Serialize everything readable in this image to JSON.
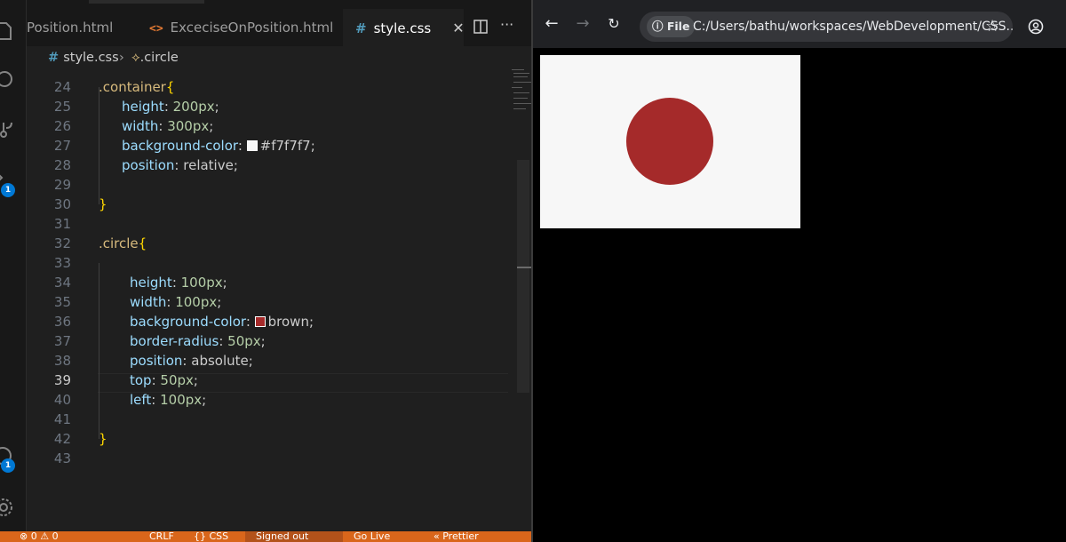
{
  "editor": {
    "tabs": [
      {
        "label": "Position.html",
        "type": "html"
      },
      {
        "label": "ExceciseOnPosition.html",
        "type": "html"
      },
      {
        "label": "style.css",
        "type": "css",
        "active": true
      }
    ],
    "breadcrumb": {
      "file": "style.css",
      "symbol": ".circle"
    },
    "lines": [
      {
        "n": "24",
        "code": [
          {
            "t": ".container",
            "c": "sel"
          },
          {
            "t": "{",
            "c": "brace"
          }
        ]
      },
      {
        "n": "25",
        "code": [
          {
            "t": "height",
            "c": "prop"
          },
          {
            "t": ": ",
            "c": "plain"
          },
          {
            "t": "200px",
            "c": "num"
          },
          {
            "t": ";",
            "c": "plain"
          }
        ]
      },
      {
        "n": "26",
        "code": [
          {
            "t": "width",
            "c": "prop"
          },
          {
            "t": ": ",
            "c": "plain"
          },
          {
            "t": "300px",
            "c": "num"
          },
          {
            "t": ";",
            "c": "plain"
          }
        ]
      },
      {
        "n": "27",
        "code": [
          {
            "t": "background-color",
            "c": "prop"
          },
          {
            "t": ": ",
            "c": "plain"
          },
          {
            "swatch": "#f7f7f7"
          },
          {
            "t": "#f7f7f7",
            "c": "plain"
          },
          {
            "t": ";",
            "c": "plain"
          }
        ]
      },
      {
        "n": "28",
        "code": [
          {
            "t": "position",
            "c": "prop"
          },
          {
            "t": ": ",
            "c": "plain"
          },
          {
            "t": "relative",
            "c": "plain"
          },
          {
            "t": ";",
            "c": "plain"
          }
        ]
      },
      {
        "n": "29",
        "code": []
      },
      {
        "n": "30",
        "code": [
          {
            "t": "}",
            "c": "brace"
          }
        ]
      },
      {
        "n": "31",
        "code": []
      },
      {
        "n": "32",
        "code": [
          {
            "t": ".circle",
            "c": "sel"
          },
          {
            "t": "{",
            "c": "brace"
          }
        ]
      },
      {
        "n": "33",
        "code": []
      },
      {
        "n": "34",
        "code": [
          {
            "t": "height",
            "c": "prop"
          },
          {
            "t": ": ",
            "c": "plain"
          },
          {
            "t": "100px",
            "c": "num"
          },
          {
            "t": ";",
            "c": "plain"
          }
        ]
      },
      {
        "n": "35",
        "code": [
          {
            "t": "width",
            "c": "prop"
          },
          {
            "t": ": ",
            "c": "plain"
          },
          {
            "t": "100px",
            "c": "num"
          },
          {
            "t": ";",
            "c": "plain"
          }
        ]
      },
      {
        "n": "36",
        "code": [
          {
            "t": "background-color",
            "c": "prop"
          },
          {
            "t": ": ",
            "c": "plain"
          },
          {
            "swatch": "#a52a2a"
          },
          {
            "t": "brown",
            "c": "plain"
          },
          {
            "t": ";",
            "c": "plain"
          }
        ]
      },
      {
        "n": "37",
        "code": [
          {
            "t": "border-radius",
            "c": "prop"
          },
          {
            "t": ": ",
            "c": "plain"
          },
          {
            "t": "50px",
            "c": "num"
          },
          {
            "t": ";",
            "c": "plain"
          }
        ]
      },
      {
        "n": "38",
        "code": [
          {
            "t": "position",
            "c": "prop"
          },
          {
            "t": ": ",
            "c": "plain"
          },
          {
            "t": "absolute",
            "c": "plain"
          },
          {
            "t": ";",
            "c": "plain"
          }
        ]
      },
      {
        "n": "39",
        "current": true,
        "code": [
          {
            "t": "top",
            "c": "prop"
          },
          {
            "t": ": ",
            "c": "plain"
          },
          {
            "t": "50px",
            "c": "num"
          },
          {
            "t": ";",
            "c": "plain"
          }
        ]
      },
      {
        "n": "40",
        "code": [
          {
            "t": "left",
            "c": "prop"
          },
          {
            "t": ": ",
            "c": "plain"
          },
          {
            "t": "100px",
            "c": "num"
          },
          {
            "t": ";",
            "c": "plain"
          }
        ]
      },
      {
        "n": "41",
        "code": []
      },
      {
        "n": "42",
        "code": [
          {
            "t": "}",
            "c": "brace"
          }
        ]
      },
      {
        "n": "43",
        "code": []
      }
    ],
    "badges": {
      "extensions": "1",
      "accounts": "1"
    },
    "status_items": [
      "⊗ 0 ⚠ 0",
      "CRLF",
      "{} CSS",
      "Signed out",
      "Go Live",
      "« Prettier"
    ]
  },
  "browser": {
    "file_chip": "File",
    "url": "C:/Users/bathu/workspaces/WebDevelopment/CSS...",
    "page": {
      "container_color": "#f7f7f7",
      "circle_color": "#a52a2a"
    }
  },
  "colors": {
    "status_bar": "#d9661b",
    "accent_badge": "#0078d4"
  }
}
